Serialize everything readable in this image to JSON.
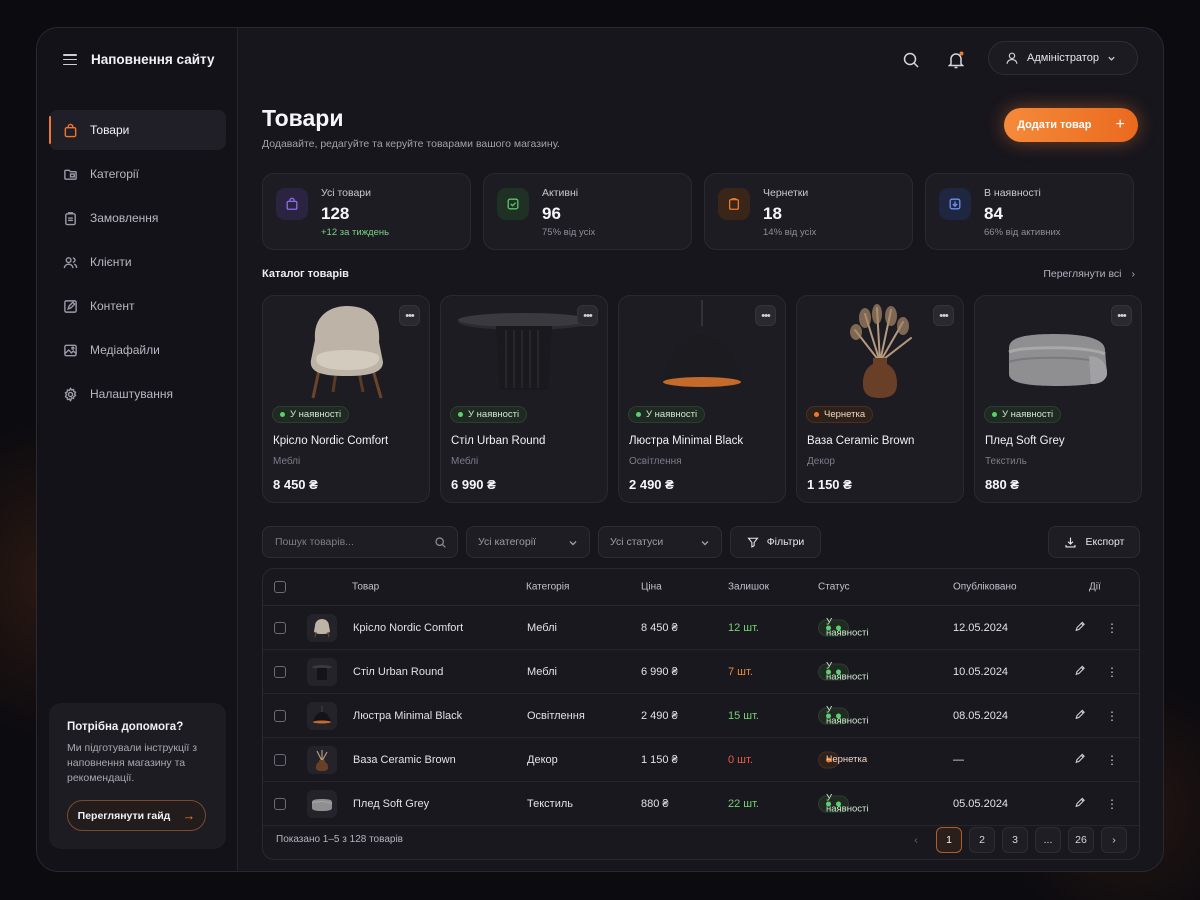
{
  "sidebar": {
    "brand": "Наповнення сайту",
    "items": [
      {
        "label": "Товари",
        "icon": "bag-icon"
      },
      {
        "label": "Категорії",
        "icon": "folder-icon"
      },
      {
        "label": "Замовлення",
        "icon": "clipboard-icon"
      },
      {
        "label": "Клієнти",
        "icon": "users-icon"
      },
      {
        "label": "Контент",
        "icon": "edit-square-icon"
      },
      {
        "label": "Медіафайли",
        "icon": "image-icon"
      },
      {
        "label": "Налаштування",
        "icon": "gear-icon"
      }
    ],
    "help": {
      "title": "Потрібна допомога?",
      "text": "Ми підготували інструкції з наповнення магазину та рекомендації.",
      "button": "Переглянути гайд"
    }
  },
  "header": {
    "user": "Адміністратор"
  },
  "page": {
    "title": "Товари",
    "subtitle": "Додавайте, редагуйте та керуйте товарами вашого магазину.",
    "add_button": "Додати товар"
  },
  "stats": [
    {
      "label": "Усі товари",
      "value": "128",
      "sub": "+12 за тиждень",
      "color": "#8b6cf0"
    },
    {
      "label": "Активні",
      "value": "96",
      "sub": "75% від усіх",
      "color": "#5cc46a"
    },
    {
      "label": "Чернетки",
      "value": "18",
      "sub": "14% від усіх",
      "color": "#f0782a"
    },
    {
      "label": "В наявності",
      "value": "84",
      "sub": "66% від активних",
      "color": "#6e8ff0"
    }
  ],
  "catalog": {
    "title": "Каталог товарів",
    "see_all": "Переглянути всі",
    "cards": [
      {
        "name": "Крісло Nordic Comfort",
        "category": "Меблі",
        "price": "8 450 ₴",
        "status": "У наявності"
      },
      {
        "name": "Стіл Urban Round",
        "category": "Меблі",
        "price": "6 990 ₴",
        "status": "У наявності"
      },
      {
        "name": "Люстра Minimal Black",
        "category": "Освітлення",
        "price": "2 490 ₴",
        "status": "У наявності"
      },
      {
        "name": "Ваза Ceramic Brown",
        "category": "Декор",
        "price": "1 150 ₴",
        "status": "Чернетка"
      },
      {
        "name": "Плед Soft Grey",
        "category": "Текстиль",
        "price": "880 ₴",
        "status": "У наявності"
      }
    ]
  },
  "toolbar": {
    "search_placeholder": "Пошук товарів...",
    "category_select": "Усі категорії",
    "status_select": "Усі статуси",
    "filters": "Фільтри",
    "export": "Експорт"
  },
  "table": {
    "headers": [
      "Товар",
      "Категорія",
      "Ціна",
      "Залишок",
      "Статус",
      "Опубліковано",
      "Дії"
    ],
    "rows": [
      {
        "name": "Крісло Nordic Comfort",
        "category": "Меблі",
        "price": "8 450 ₴",
        "stock": "12 шт.",
        "status": "У наявності",
        "published": "12.05.2024"
      },
      {
        "name": "Стіл Urban Round",
        "category": "Меблі",
        "price": "6 990 ₴",
        "stock": "7 шт.",
        "status": "У наявності",
        "published": "10.05.2024"
      },
      {
        "name": "Люстра Minimal Black",
        "category": "Освітлення",
        "price": "2 490 ₴",
        "stock": "15 шт.",
        "status": "У наявності",
        "published": "08.05.2024"
      },
      {
        "name": "Ваза Ceramic Brown",
        "category": "Декор",
        "price": "1 150 ₴",
        "stock": "0 шт.",
        "status": "Чернетка",
        "published": "—"
      },
      {
        "name": "Плед Soft Grey",
        "category": "Текстиль",
        "price": "880 ₴",
        "stock": "22 шт.",
        "status": "У наявності",
        "published": "05.05.2024"
      }
    ],
    "footer": "Показано 1–5 з 128 товарів",
    "pages": [
      "1",
      "2",
      "3",
      "...",
      "26"
    ]
  },
  "colors": {
    "accent": "#f0782a",
    "in_stock": "#5cd069",
    "low_stock": "#f0893a",
    "out_of_stock": "#ef5a45"
  }
}
